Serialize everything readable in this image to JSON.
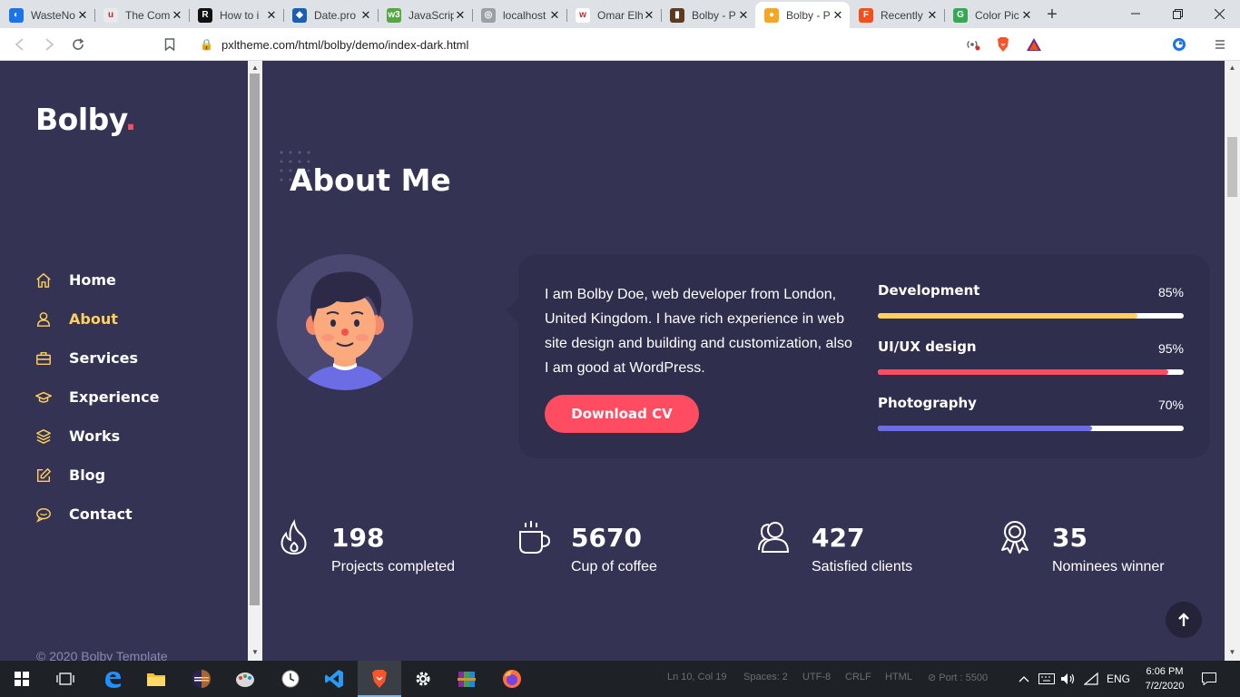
{
  "browser": {
    "tabs": [
      {
        "title": "WasteNo",
        "fav_color": "#1a73e8",
        "fav_glyph": "◐"
      },
      {
        "title": "The Com",
        "fav_color": "#e8eaed",
        "fav_glyph": "u"
      },
      {
        "title": "How to i",
        "fav_color": "#111111",
        "fav_glyph": "R"
      },
      {
        "title": "Date.pro",
        "fav_color": "#1a5fb4",
        "fav_glyph": "◆"
      },
      {
        "title": "JavaScrip",
        "fav_color": "#53a93f",
        "fav_glyph": "w3"
      },
      {
        "title": "localhost",
        "fav_color": "#9aa0a6",
        "fav_glyph": "◎"
      },
      {
        "title": "Omar Elh",
        "fav_color": "#ffffff",
        "fav_glyph": "w"
      },
      {
        "title": "Bolby - P",
        "fav_color": "#5b3a1e",
        "fav_glyph": "▮"
      },
      {
        "title": "Bolby - P",
        "fav_color": "#f5a623",
        "fav_glyph": "●",
        "active": true
      },
      {
        "title": "Recently",
        "fav_color": "#f24e1e",
        "fav_glyph": "F"
      },
      {
        "title": "Color Pic",
        "fav_color": "#34a853",
        "fav_glyph": "G"
      }
    ],
    "new_tab_glyph": "+",
    "url": "pxltheme.com/html/bolby/demo/index-dark.html"
  },
  "sidebar": {
    "logo": "Bolby",
    "logo_dot": ".",
    "nav": [
      {
        "label": "Home",
        "icon": "home-icon"
      },
      {
        "label": "About",
        "icon": "user-icon",
        "active": true
      },
      {
        "label": "Services",
        "icon": "briefcase-icon"
      },
      {
        "label": "Experience",
        "icon": "graduation-cap-icon"
      },
      {
        "label": "Works",
        "icon": "layers-icon"
      },
      {
        "label": "Blog",
        "icon": "edit-icon"
      },
      {
        "label": "Contact",
        "icon": "chat-icon"
      }
    ],
    "copyright": "© 2020 Bolby Template"
  },
  "about": {
    "title": "About Me",
    "bio": "I am Bolby Doe, web developer from London, United Kingdom. I have rich experience in web site design and building and customization, also I am good at WordPress.",
    "cv_button": "Download CV",
    "skills": [
      {
        "name": "Development",
        "percent_label": "85%",
        "value": 85,
        "color": "#ffd15c"
      },
      {
        "name": "UI/UX design",
        "percent_label": "95%",
        "value": 95,
        "color": "#ff4c60"
      },
      {
        "name": "Photography",
        "percent_label": "70%",
        "value": 70,
        "color": "#6c6ce5"
      }
    ]
  },
  "facts": [
    {
      "number": "198",
      "label": "Projects completed",
      "icon": "fire-icon"
    },
    {
      "number": "5670",
      "label": "Cup of coffee",
      "icon": "coffee-cup-icon"
    },
    {
      "number": "427",
      "label": "Satisfied clients",
      "icon": "users-icon"
    },
    {
      "number": "35",
      "label": "Nominees winner",
      "icon": "award-badge-icon"
    }
  ],
  "taskbar": {
    "status_ghost": [
      "Ln 10, Col 19",
      "Spaces: 2",
      "UTF-8",
      "CRLF",
      "HTML",
      "⊘ Port : 5500"
    ],
    "language": "ENG",
    "time": "6:06 PM",
    "date": "7/2/2020"
  },
  "colors": {
    "background": "#353353",
    "accent_red": "#ff4c60",
    "accent_yellow": "#ffd15c",
    "accent_purple": "#6c6ce5"
  }
}
